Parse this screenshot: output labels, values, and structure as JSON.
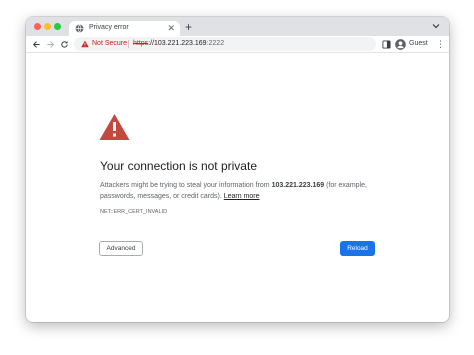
{
  "tab": {
    "title": "Privacy error",
    "icon": "globe-icon"
  },
  "toolbar": {
    "security_label": "Not Secure",
    "url_scheme": "https",
    "url_rest": "://103.221.223.169",
    "url_port": ":2222",
    "profile_label": "Guest"
  },
  "page": {
    "heading": "Your connection is not private",
    "desc_before": "Attackers might be trying to steal your information from ",
    "desc_host": "103.221.223.169",
    "desc_after": " (for example, passwords, messages, or credit cards). ",
    "learn_more": "Learn more",
    "error_code": "NET::ERR_CERT_INVALID",
    "advanced_button": "Advanced",
    "reload_button": "Reload"
  },
  "colors": {
    "danger": "#c5221f",
    "accent": "#1a73e8",
    "warning_icon": "#c4483d"
  }
}
